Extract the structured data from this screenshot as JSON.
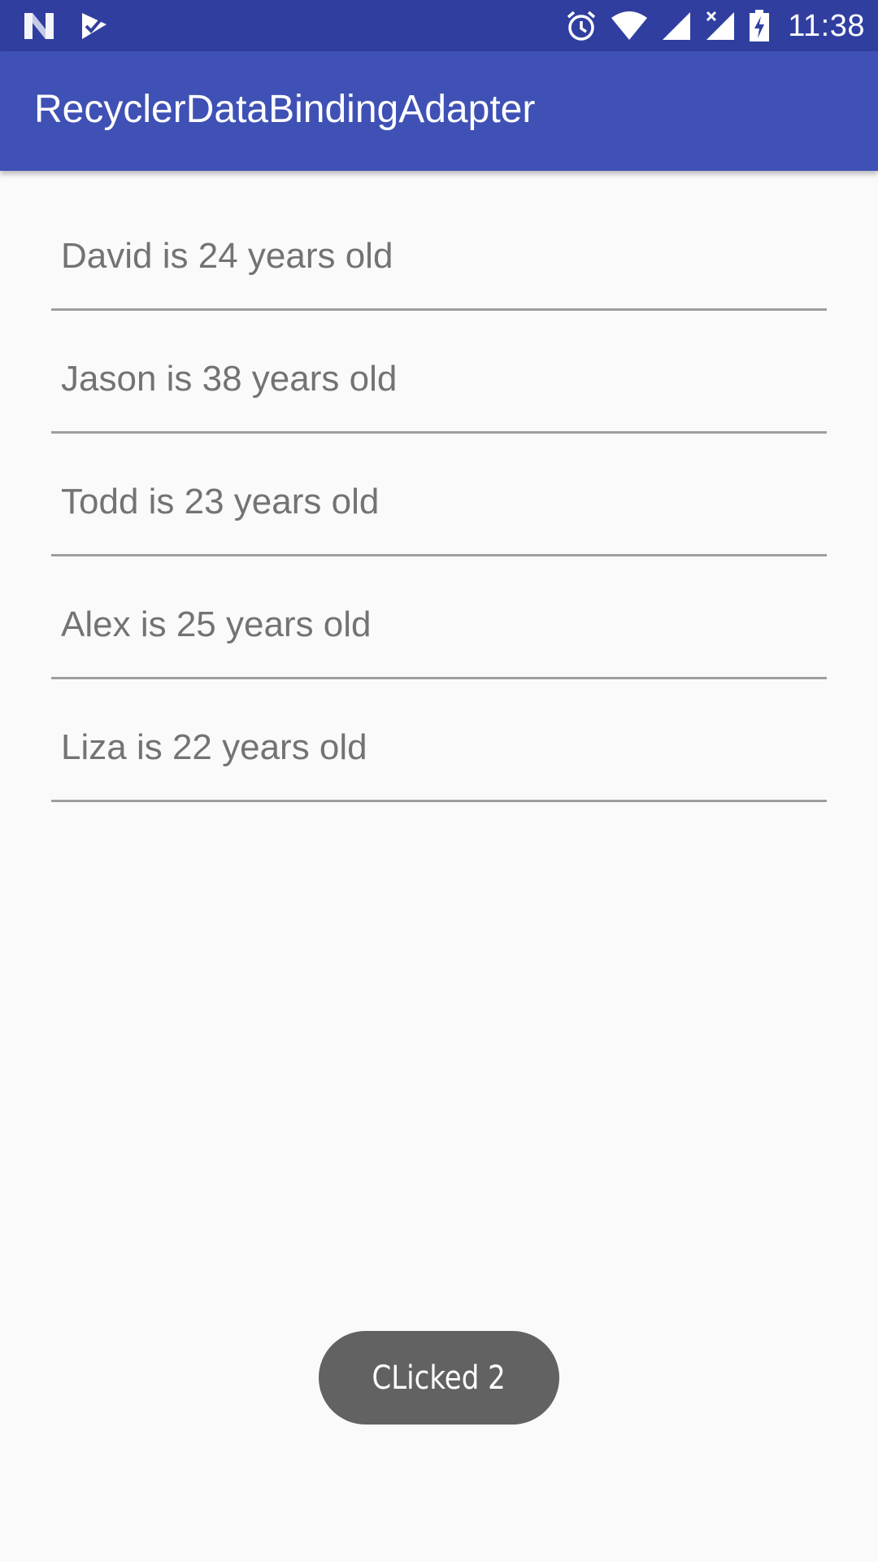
{
  "status_bar": {
    "time": "11:38",
    "left_icons": [
      "n-logo-icon",
      "checkmark-notification-icon"
    ],
    "right_icons": [
      "alarm-icon",
      "wifi-icon",
      "cell-signal-icon",
      "cell-signal-no-data-icon",
      "battery-charging-icon"
    ],
    "background": "#303f9f"
  },
  "app_bar": {
    "title": "RecyclerDataBindingAdapter",
    "background": "#3f51b5"
  },
  "list": {
    "items": [
      {
        "text": "David is 24 years old"
      },
      {
        "text": "Jason is 38 years old"
      },
      {
        "text": "Todd is 23 years old"
      },
      {
        "text": "Alex is 25 years old"
      },
      {
        "text": "Liza is 22 years old"
      }
    ],
    "text_color": "#737373",
    "divider_color": "#9e9e9e"
  },
  "toast": {
    "text": "CLicked 2",
    "background": "#626262"
  }
}
